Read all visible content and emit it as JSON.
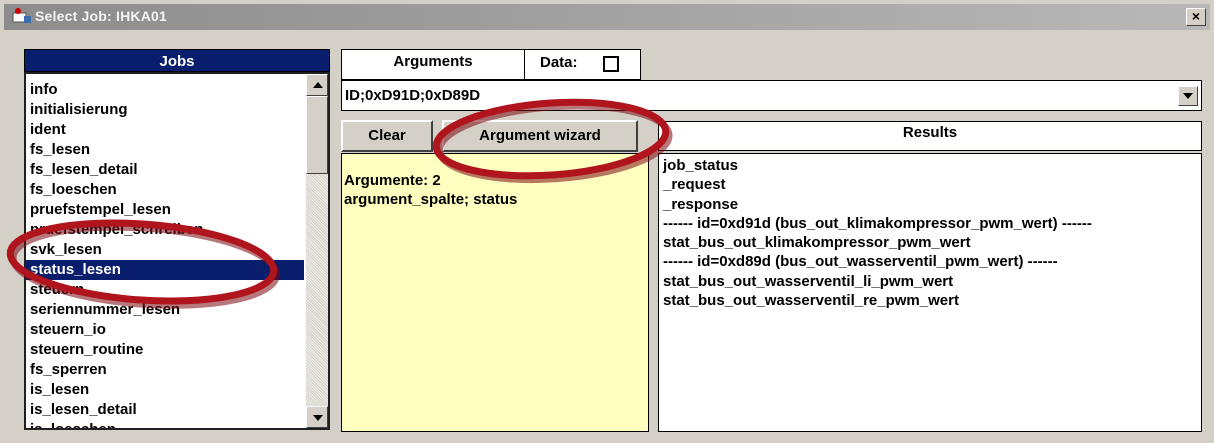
{
  "window": {
    "title": "Select Job: IHKA01",
    "close_label": "×"
  },
  "jobs": {
    "header": "Jobs",
    "items": [
      {
        "label": "info",
        "selected": false
      },
      {
        "label": "initialisierung",
        "selected": false
      },
      {
        "label": "ident",
        "selected": false
      },
      {
        "label": "fs_lesen",
        "selected": false
      },
      {
        "label": "fs_lesen_detail",
        "selected": false
      },
      {
        "label": "fs_loeschen",
        "selected": false
      },
      {
        "label": "pruefstempel_lesen",
        "selected": false
      },
      {
        "label": "pruefstempel_schreiben",
        "selected": false
      },
      {
        "label": "svk_lesen",
        "selected": false
      },
      {
        "label": "status_lesen",
        "selected": true
      },
      {
        "label": "steuern",
        "selected": false
      },
      {
        "label": "seriennummer_lesen",
        "selected": false
      },
      {
        "label": "steuern_io",
        "selected": false
      },
      {
        "label": "steuern_routine",
        "selected": false
      },
      {
        "label": "fs_sperren",
        "selected": false
      },
      {
        "label": "is_lesen",
        "selected": false
      },
      {
        "label": "is_lesen_detail",
        "selected": false
      },
      {
        "label": "is_loeschen",
        "selected": false
      }
    ]
  },
  "arguments": {
    "tab_label": "Arguments",
    "data_label": "Data:",
    "data_checked": false,
    "value": "ID;0xD91D;0xD89D",
    "clear_label": "Clear",
    "wizard_label": "Argument wizard",
    "info_lines": [
      "Argumente:  2",
      "argument_spalte; status"
    ]
  },
  "results": {
    "header": "Results",
    "lines": [
      "job_status",
      "_request",
      "_response",
      "------ id=0xd91d (bus_out_klimakompressor_pwm_wert) ------",
      "stat_bus_out_klimakompressor_pwm_wert",
      "------ id=0xd89d (bus_out_wasserventil_pwm_wert) ------",
      "stat_bus_out_wasserventil_li_pwm_wert",
      "stat_bus_out_wasserventil_re_pwm_wert"
    ]
  },
  "colors": {
    "selection": "#0a1e6e",
    "annotation": "#b0141c",
    "args_background": "#ffffc0"
  }
}
